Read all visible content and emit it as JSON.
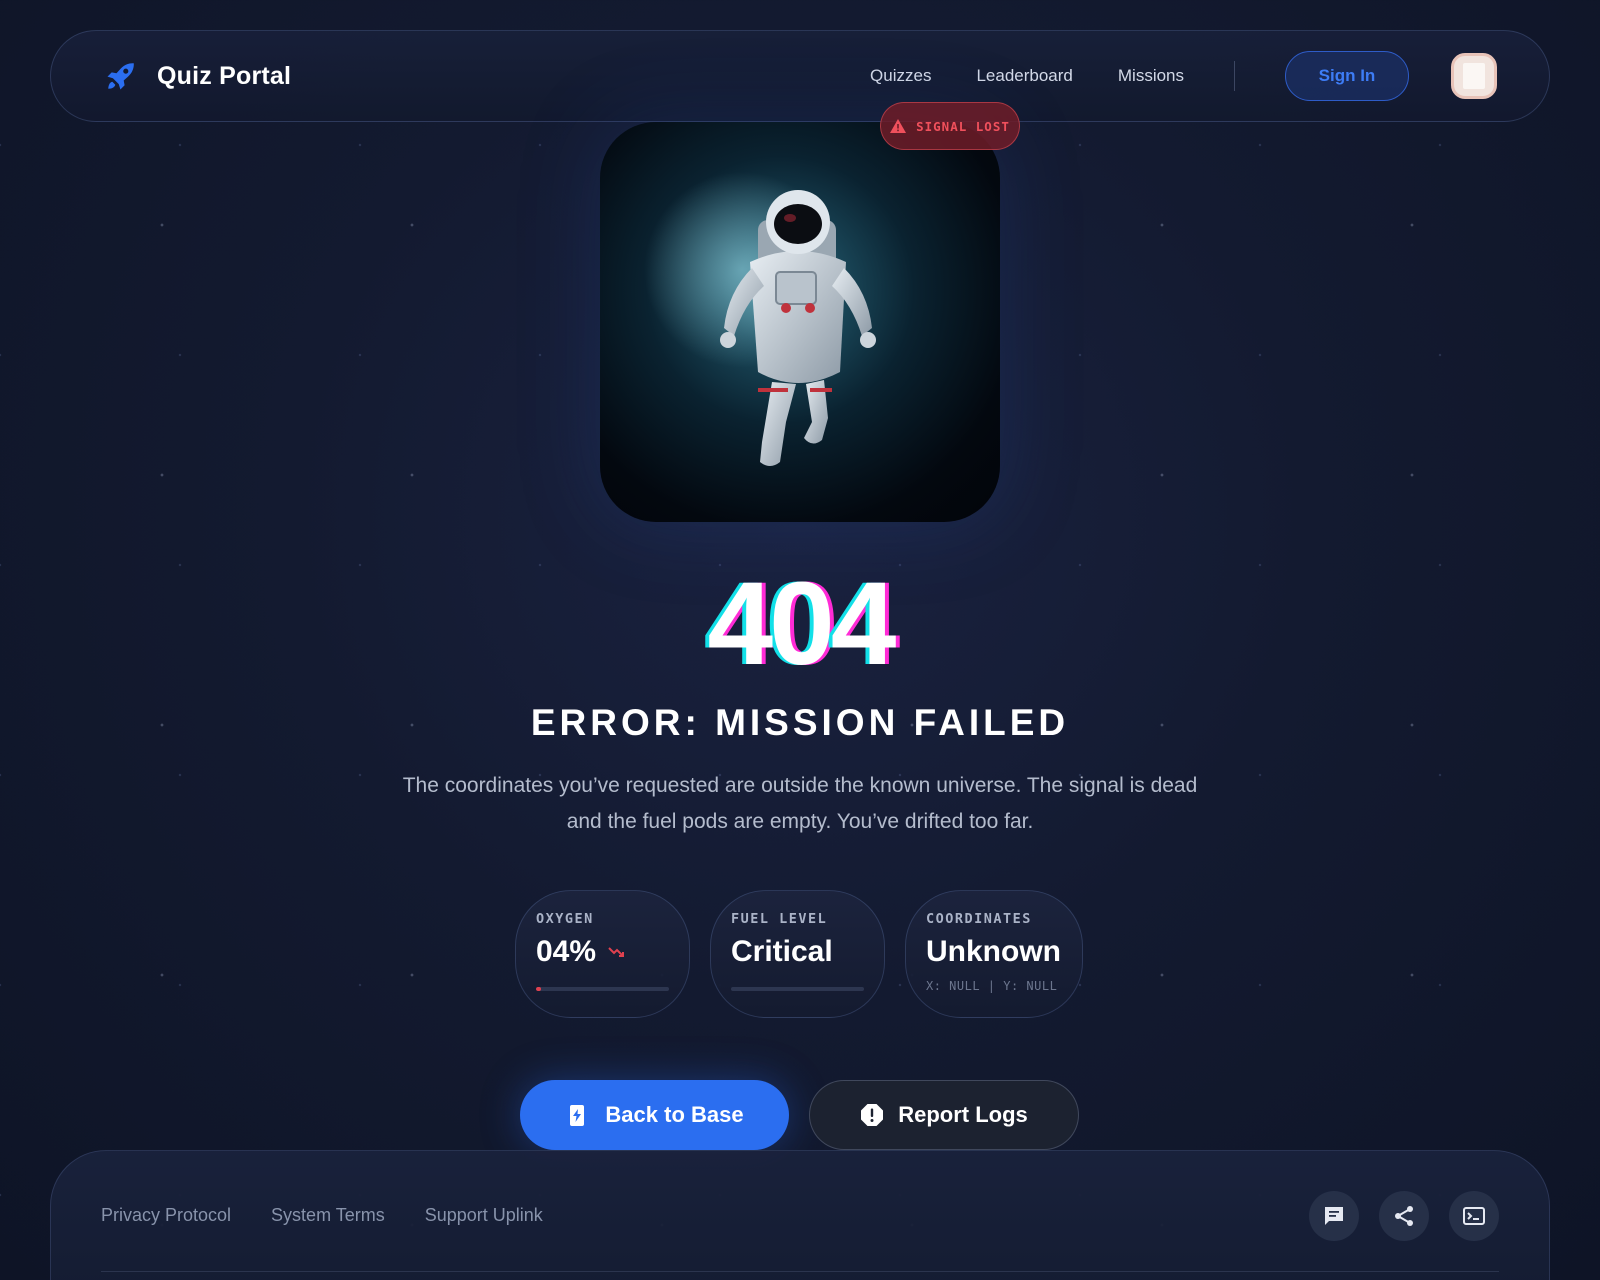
{
  "header": {
    "brand": "Quiz Portal",
    "logo_icon": "rocket-icon",
    "nav": [
      {
        "label": "Quizzes"
      },
      {
        "label": "Leaderboard"
      },
      {
        "label": "Missions"
      }
    ],
    "sign_in_label": "Sign In",
    "avatar_icon": "user-avatar"
  },
  "badge": {
    "label": "SIGNAL LOST",
    "icon": "warning-triangle-icon",
    "color": "#f0505c"
  },
  "hero": {
    "image": "astronaut-floating-in-space"
  },
  "error": {
    "code": "404",
    "title": "ERROR: MISSION FAILED",
    "description": "The coordinates you’ve requested are outside the known universe. The signal is dead and the fuel pods are empty. You’ve drifted too far."
  },
  "stats": {
    "oxygen": {
      "label": "OXYGEN",
      "value": "04%",
      "level": 0.04,
      "trend_icon": "trending-down-icon"
    },
    "fuel": {
      "label": "FUEL LEVEL",
      "value": "Critical",
      "level": 0
    },
    "coordinates": {
      "label": "COORDINATES",
      "value": "Unknown",
      "sub": "X: NULL | Y: NULL"
    }
  },
  "actions": {
    "primary": {
      "label": "Back to Base",
      "icon": "battery-charging-icon"
    },
    "secondary": {
      "label": "Report Logs",
      "icon": "alert-octagon-icon"
    }
  },
  "footer": {
    "links": [
      {
        "label": "Privacy Protocol"
      },
      {
        "label": "System Terms"
      },
      {
        "label": "Support Uplink"
      }
    ],
    "icons": [
      "chat-icon",
      "share-icon",
      "terminal-icon"
    ]
  },
  "colors": {
    "accent": "#2b6ef0",
    "danger": "#e0414f",
    "background": "#131a30"
  }
}
